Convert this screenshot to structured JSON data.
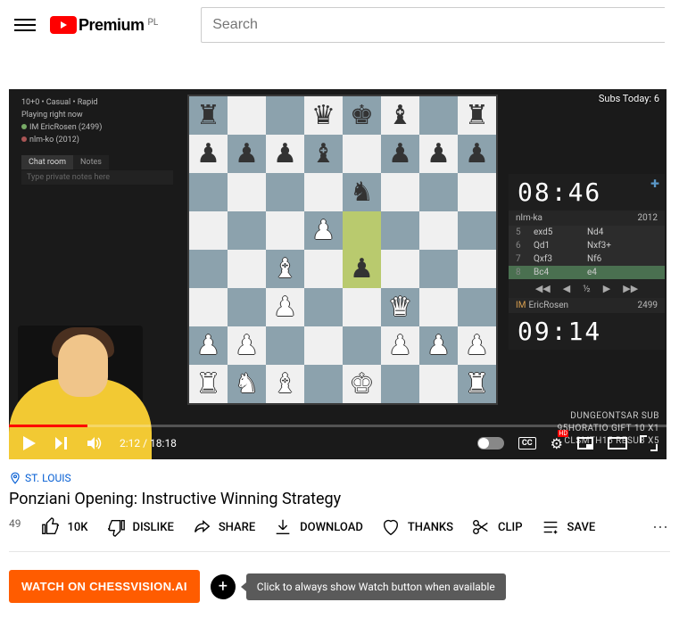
{
  "header": {
    "logo_text": "Premium",
    "country": "PL",
    "search_placeholder": "Search"
  },
  "video": {
    "subs_today": "Subs Today: 6",
    "side1": "DUNGEONTSAR  SUB",
    "side3": "CLSMTH15  RESUB X5",
    "lichess_mode": "10+0 • Casual • Rapid",
    "lichess_state": "Playing right now",
    "p1": "IM EricRosen (2499)",
    "p2": "nlm-ko (2012)",
    "tab_chat": "Chat room",
    "tab_notes": "Notes",
    "privnotes": "Type private notes here",
    "top_clock": "08:46",
    "bot_clock": "09:14",
    "top_name": "nlm-ka",
    "top_rating": "2012",
    "bot_name": "EricRosen",
    "bot_rating": "2499",
    "bot_im": "IM",
    "moves": [
      {
        "n": "5",
        "w": "exd5",
        "b": "Nd4"
      },
      {
        "n": "6",
        "w": "Qd1",
        "b": "Nxf3+"
      },
      {
        "n": "7",
        "w": "Qxf3",
        "b": "Nf6"
      },
      {
        "n": "8",
        "w": "Bc4",
        "b": "e4"
      }
    ],
    "nav_half": "½",
    "time_current": "2:12",
    "time_total": "18:18",
    "cc_label": "CC",
    "hd_label": "HD"
  },
  "meta": {
    "location": "ST. LOUIS",
    "title": "Ponziani Opening: Instructive Winning Strategy",
    "views": "49"
  },
  "actions": {
    "like": "10K",
    "dislike": "DISLIKE",
    "share": "SHARE",
    "download": "DOWNLOAD",
    "thanks": "THANKS",
    "clip": "CLIP",
    "save": "SAVE"
  },
  "ext": {
    "button": "WATCH ON CHESSVISION.AI",
    "tooltip": "Click to always show Watch button when available"
  },
  "board": {
    "pieces": {
      "a8": "br",
      "d8": "bq",
      "e8": "bk",
      "f8": "bb",
      "h8": "br",
      "a7": "bp",
      "b7": "bp",
      "c7": "bp",
      "d7": "bb",
      "f7": "bp",
      "g7": "bp",
      "h7": "bp",
      "e6": "bn",
      "d5": "wp",
      "c4": "wb",
      "e4": "bp",
      "c3": "wp",
      "f3": "wq",
      "a2": "wp",
      "b2": "wp",
      "f2": "wp",
      "g2": "wp",
      "h2": "wp",
      "a1": "wr",
      "b1": "wn",
      "c1": "wb",
      "e1": "wk",
      "h1": "wr"
    },
    "highlights": [
      "e5",
      "e4"
    ]
  }
}
